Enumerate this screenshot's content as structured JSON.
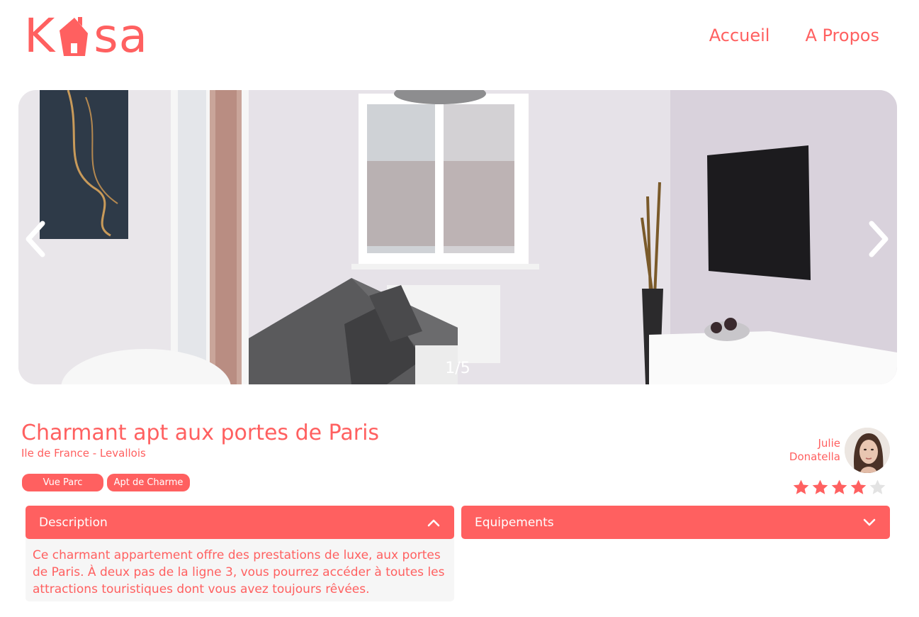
{
  "header": {
    "logo_text_left": "K",
    "logo_text_right": "sa",
    "nav": [
      {
        "label": "Accueil"
      },
      {
        "label": "A Propos"
      }
    ]
  },
  "carousel": {
    "counter": "1/5",
    "current": 1,
    "total": 5,
    "prev_icon": "chevron-left-icon",
    "next_icon": "chevron-right-icon"
  },
  "listing": {
    "title": "Charmant apt aux portes de Paris",
    "location": "Ile de France - Levallois",
    "tags": [
      "Vue Parc",
      "Apt de Charme"
    ],
    "host": {
      "first_name": "Julie",
      "last_name": "Donatella"
    },
    "rating": 4,
    "rating_max": 5
  },
  "collapses": {
    "description": {
      "label": "Description",
      "expanded": true,
      "text": "Ce charmant appartement offre des prestations de luxe, aux portes de Paris. À deux pas de la ligne 3, vous pourrez accéder à toutes les attractions touristiques dont vous avez toujours rêvées."
    },
    "equipments": {
      "label": "Equipements",
      "expanded": false
    }
  },
  "colors": {
    "accent": "#FF6060",
    "panel_bg": "#F6F6F6",
    "star_off": "#E3E3E3"
  }
}
